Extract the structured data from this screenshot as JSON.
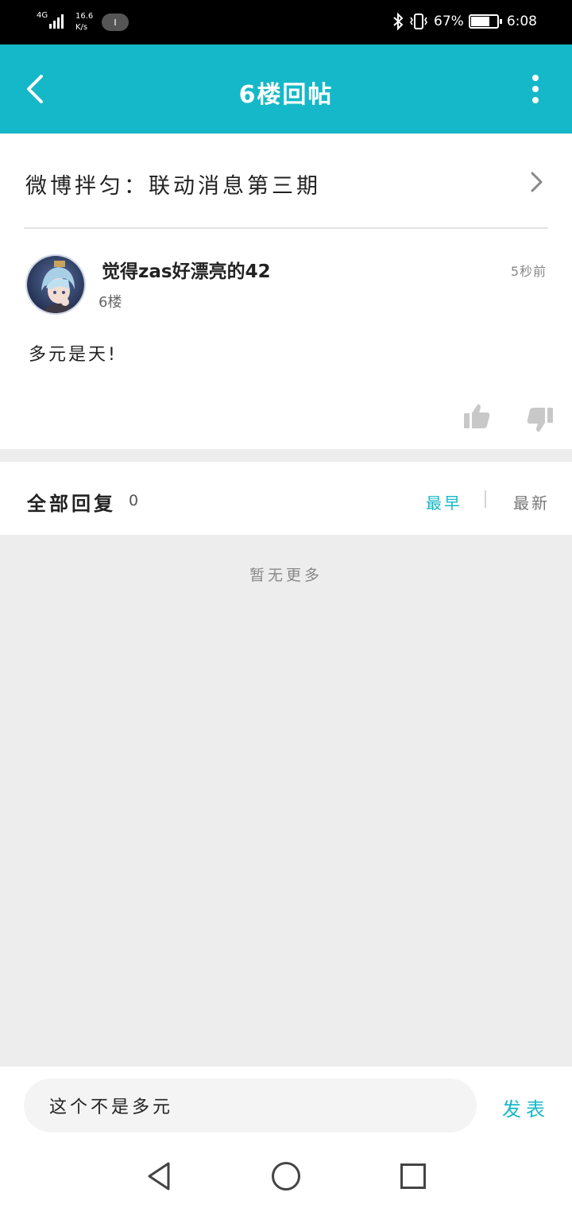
{
  "status_bar": {
    "signal_type": "4G",
    "net_speed": "16.6",
    "net_unit": "K/s",
    "battery_percent": "67%",
    "battery_level": 0.67,
    "time": "6:08"
  },
  "app_bar": {
    "title": "6楼回帖",
    "back_icon": "chevron-left-icon",
    "more_icon": "more-vertical-icon"
  },
  "topic": {
    "title": "微博拌匀：联动消息第三期",
    "chevron_icon": "chevron-right-icon"
  },
  "post": {
    "username": "觉得zas好漂亮的42",
    "floor": "6楼",
    "time": "5秒前",
    "content": "多元是天!",
    "like_icon": "thumbs-up-icon",
    "dislike_icon": "thumbs-down-icon"
  },
  "replies": {
    "label": "全部回复",
    "count": "0",
    "sort_earliest": "最早",
    "sort_latest": "最新",
    "empty_text": "暂无更多"
  },
  "compose": {
    "value": "这个不是多元",
    "send_label": "发表"
  },
  "colors": {
    "accent": "#15b8c8",
    "background_gray": "#ededed"
  }
}
